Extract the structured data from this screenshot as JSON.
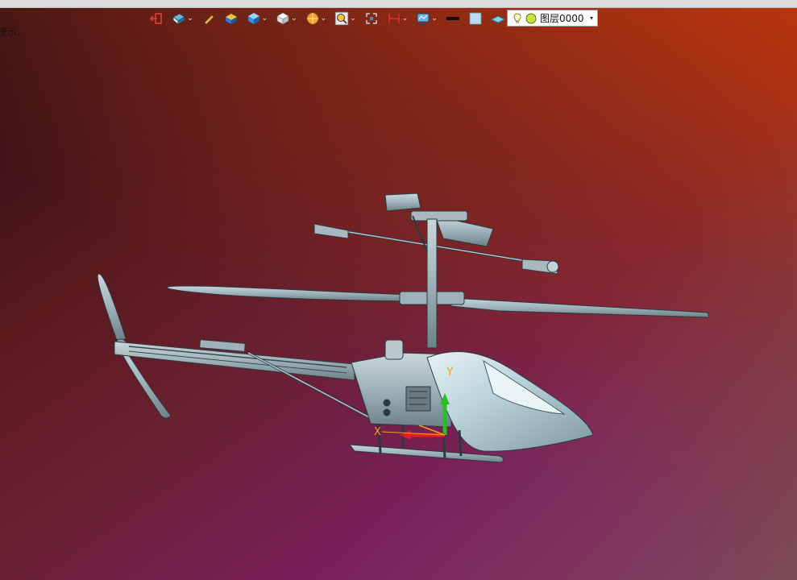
{
  "hint_text": "提示.",
  "toolbar": {
    "buttons": [
      {
        "icon": "exit-icon",
        "dropdown": false
      },
      {
        "icon": "render-mode-icon",
        "dropdown": true
      },
      {
        "icon": "pencil-icon",
        "dropdown": false
      },
      {
        "icon": "box-select-icon",
        "dropdown": false
      },
      {
        "icon": "shaded-cube-icon",
        "dropdown": true
      },
      {
        "icon": "white-cube-icon",
        "dropdown": true
      },
      {
        "icon": "section-view-icon",
        "dropdown": true
      },
      {
        "icon": "zoom-fit-icon",
        "dropdown": true
      },
      {
        "icon": "snap-icon",
        "dropdown": false
      },
      {
        "icon": "dimension-icon",
        "dropdown": true
      },
      {
        "icon": "display-settings-icon",
        "dropdown": true
      },
      {
        "icon": "line-color-icon",
        "dropdown": false
      },
      {
        "icon": "fill-color-icon",
        "dropdown": false
      },
      {
        "icon": "layer-plane-icon",
        "dropdown": true
      }
    ],
    "dropdown_glyph": "⌄"
  },
  "layer_selector": {
    "label": "图层0000",
    "dropdown_glyph": "▾",
    "icons": [
      "bulb-icon",
      "layer-status-icon"
    ]
  },
  "viewport": {
    "axis_labels": {
      "y": "Y",
      "x": "X"
    },
    "model": "helicopter"
  }
}
